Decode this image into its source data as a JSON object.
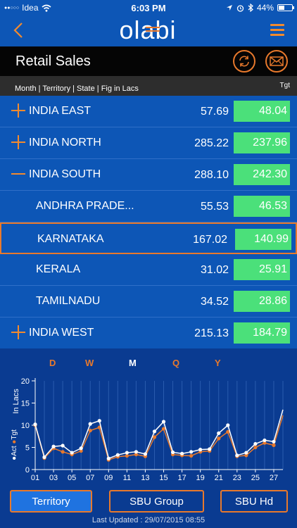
{
  "status_bar": {
    "carrier": "Idea",
    "time": "6:03 PM",
    "battery": "44%"
  },
  "app": {
    "logo_text": "olabi"
  },
  "header": {
    "title": "Retail Sales"
  },
  "filter": {
    "text": "Month | Territory | State | Fig in Lacs",
    "tgt_label": "Tgt"
  },
  "rows": [
    {
      "label": "INDIA EAST",
      "act": "57.69",
      "tgt": "48.04",
      "level": 1,
      "expander": "plus"
    },
    {
      "label": "INDIA NORTH",
      "act": "285.22",
      "tgt": "237.96",
      "level": 1,
      "expander": "plus"
    },
    {
      "label": "INDIA SOUTH",
      "act": "288.10",
      "tgt": "242.30",
      "level": 1,
      "expander": "minus"
    },
    {
      "label": "ANDHRA PRADE...",
      "act": "55.53",
      "tgt": "46.53",
      "level": 2
    },
    {
      "label": "KARNATAKA",
      "act": "167.02",
      "tgt": "140.99",
      "level": 2,
      "selected": true
    },
    {
      "label": "KERALA",
      "act": "31.02",
      "tgt": "25.91",
      "level": 2
    },
    {
      "label": "TAMILNADU",
      "act": "34.52",
      "tgt": "28.86",
      "level": 2
    },
    {
      "label": "INDIA WEST",
      "act": "215.13",
      "tgt": "184.79",
      "level": 1,
      "expander": "plus"
    }
  ],
  "period_tabs": [
    {
      "label": "D",
      "active": false
    },
    {
      "label": "W",
      "active": false
    },
    {
      "label": "M",
      "active": true
    },
    {
      "label": "Q",
      "active": false
    },
    {
      "label": "Y",
      "active": false
    }
  ],
  "chart_data": {
    "type": "line",
    "ylabel": "In Lacs",
    "ylim": [
      0,
      20
    ],
    "yticks": [
      0,
      5,
      10,
      15,
      20
    ],
    "xticks": [
      "01",
      "03",
      "05",
      "07",
      "09",
      "11",
      "13",
      "15",
      "17",
      "19",
      "21",
      "23",
      "25",
      "27"
    ],
    "x": [
      1,
      2,
      3,
      4,
      5,
      6,
      7,
      8,
      9,
      10,
      11,
      12,
      13,
      14,
      15,
      16,
      17,
      18,
      19,
      20,
      21,
      22,
      23,
      24,
      25,
      26,
      27,
      28
    ],
    "series": [
      {
        "name": "Act",
        "color": "#ffffff",
        "values": [
          10.2,
          2.8,
          5.2,
          5.4,
          3.8,
          4.8,
          10.3,
          11.0,
          2.5,
          3.3,
          3.8,
          4.0,
          3.5,
          8.6,
          10.8,
          3.9,
          3.6,
          4.0,
          4.5,
          4.6,
          8.2,
          10.0,
          3.2,
          3.8,
          5.8,
          6.6,
          6.3,
          13.5
        ]
      },
      {
        "name": "Tgt",
        "color": "#e8792c",
        "values": [
          10.0,
          2.6,
          4.8,
          4.0,
          3.4,
          4.2,
          8.8,
          9.5,
          2.2,
          2.9,
          3.1,
          3.4,
          3.0,
          7.3,
          9.2,
          3.4,
          3.2,
          3.1,
          4.0,
          4.2,
          7.0,
          8.5,
          3.0,
          3.2,
          5.0,
          6.0,
          5.5,
          12.2
        ]
      }
    ]
  },
  "bottom_buttons": {
    "territory": "Territory",
    "sbu_group": "SBU Group",
    "sbu_hd": "SBU Hd"
  },
  "last_updated": "Last Updated : 29/07/2015 08:55"
}
